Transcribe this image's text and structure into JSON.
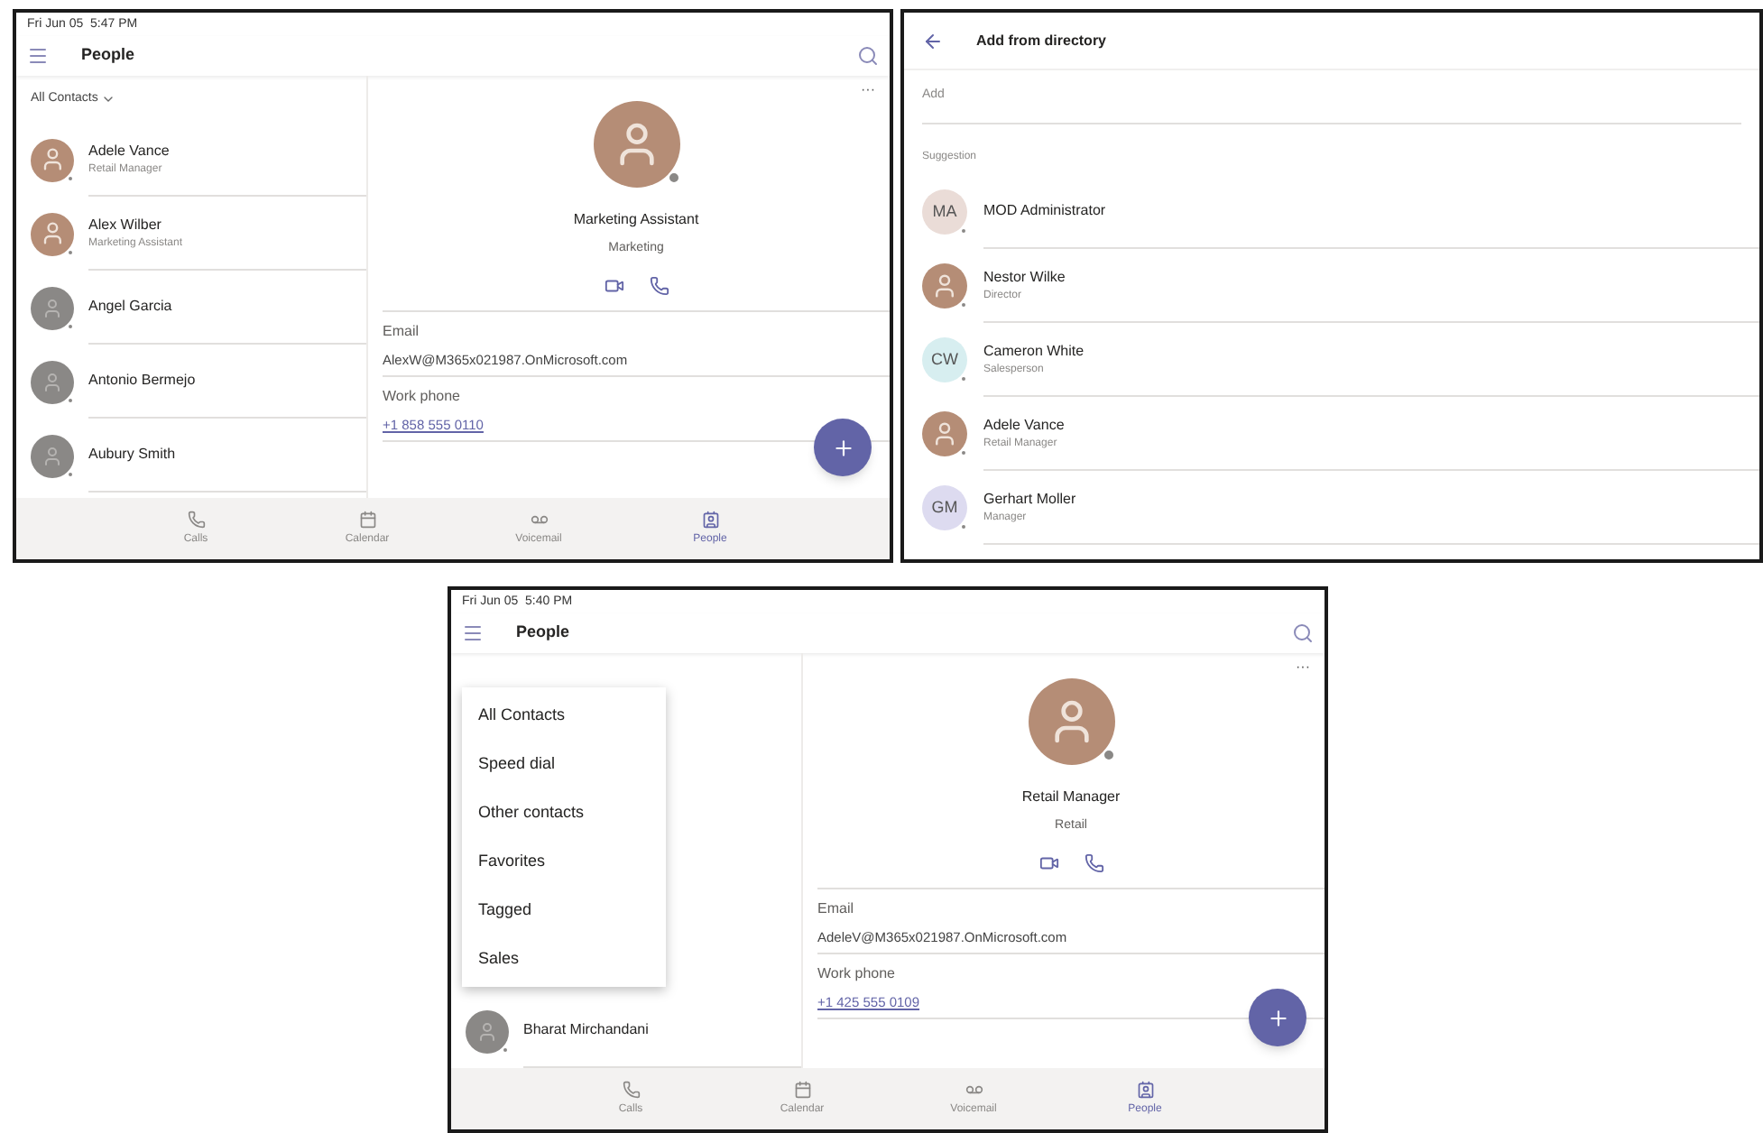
{
  "people_screen": {
    "status_time": "Fri Jun 05  5:47 PM",
    "title": "People",
    "filter": "All Contacts",
    "contacts": [
      {
        "name": "Adele Vance",
        "subtitle": "Retail Manager",
        "kind": "photo"
      },
      {
        "name": "Alex Wilber",
        "subtitle": "Marketing Assistant",
        "kind": "photo"
      },
      {
        "name": "Angel Garcia",
        "kind": "default"
      },
      {
        "name": "Antonio Bermejo",
        "kind": "default"
      },
      {
        "name": "Aubury Smith",
        "kind": "default"
      }
    ],
    "detail": {
      "more": "···",
      "job_title": "Marketing Assistant",
      "department": "Marketing",
      "email_label": "Email",
      "email": "AlexW@M365x021987.OnMicrosoft.com",
      "phone_label": "Work phone",
      "phone": "+1 858 555 0110"
    },
    "nav": [
      {
        "label": "Calls",
        "selected": false
      },
      {
        "label": "Calendar",
        "selected": false
      },
      {
        "label": "Voicemail",
        "selected": false
      },
      {
        "label": "People",
        "selected": true
      }
    ]
  },
  "directory_screen": {
    "title": "Add from directory",
    "field_placeholder": "Add",
    "section": "Suggestion",
    "suggestions": [
      {
        "name": "MOD Administrator",
        "kind": "initials",
        "initials": "MA",
        "color": "#eadcd7"
      },
      {
        "name": "Nestor Wilke",
        "subtitle": "Director",
        "kind": "photo"
      },
      {
        "name": "Cameron White",
        "subtitle": "Salesperson",
        "kind": "initials",
        "initials": "CW",
        "color": "#d7eef0"
      },
      {
        "name": "Adele Vance",
        "subtitle": "Retail Manager",
        "kind": "photo"
      },
      {
        "name": "Gerhart Moller",
        "subtitle": "Manager",
        "kind": "initials",
        "initials": "GM",
        "color": "#dddbf0"
      }
    ]
  },
  "people_menu_screen": {
    "status_time": "Fri Jun 05  5:40 PM",
    "title": "People",
    "contacts": [
      {
        "name": "Bharat Mirchandani",
        "kind": "default"
      }
    ],
    "menu": [
      {
        "label": "All Contacts"
      },
      {
        "label": "Speed dial"
      },
      {
        "label": "Other contacts"
      },
      {
        "label": "Favorites"
      },
      {
        "label": "Tagged"
      },
      {
        "label": "Sales"
      }
    ],
    "detail": {
      "more": "···",
      "job_title": "Retail Manager",
      "department": "Retail",
      "email_label": "Email",
      "email": "AdeleV@M365x021987.OnMicrosoft.com",
      "phone_label": "Work phone",
      "phone": "+1 425 555 0109"
    },
    "nav": [
      {
        "label": "Calls",
        "selected": false
      },
      {
        "label": "Calendar",
        "selected": false
      },
      {
        "label": "Voicemail",
        "selected": false
      },
      {
        "label": "People",
        "selected": true
      }
    ]
  }
}
